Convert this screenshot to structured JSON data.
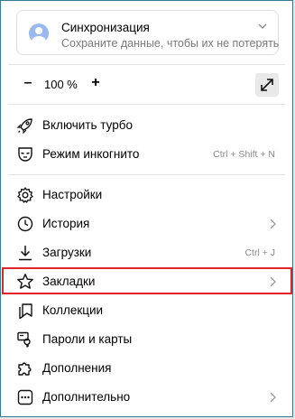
{
  "sync": {
    "title": "Синхронизация",
    "subtitle": "Сохраните данные, чтобы их не потерять"
  },
  "zoom": {
    "minus": "–",
    "value": "100 %",
    "plus": "+"
  },
  "menu": {
    "turbo": {
      "label": "Включить турбо"
    },
    "incognito": {
      "label": "Режим инкогнито",
      "shortcut": "Ctrl + Shift + N"
    },
    "settings": {
      "label": "Настройки"
    },
    "history": {
      "label": "История"
    },
    "downloads": {
      "label": "Загрузки",
      "shortcut": "Ctrl + J"
    },
    "bookmarks": {
      "label": "Закладки"
    },
    "collections": {
      "label": "Коллекции"
    },
    "passwords": {
      "label": "Пароли и карты"
    },
    "extensions": {
      "label": "Дополнения"
    },
    "more": {
      "label": "Дополнительно"
    }
  },
  "colors": {
    "highlight": "#e0242a",
    "avatar": "#9bb8f0",
    "window_border": "#3a7a8c"
  }
}
